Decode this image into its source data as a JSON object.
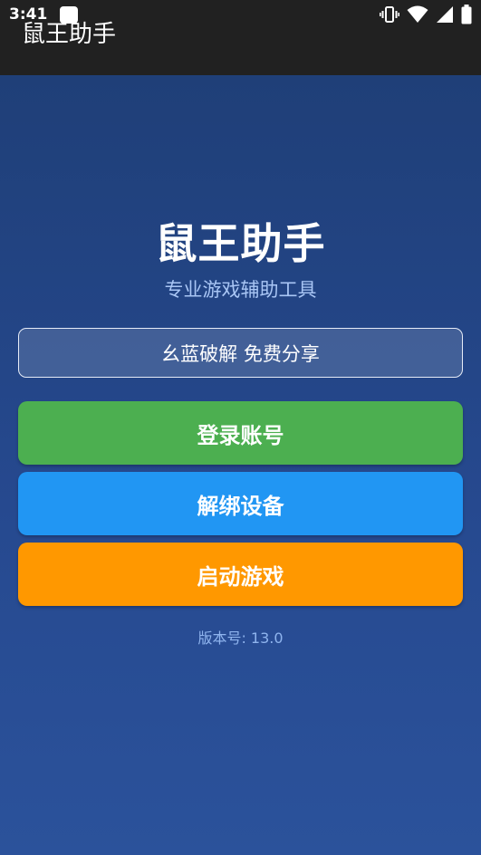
{
  "status_bar": {
    "time": "3:41",
    "icons": [
      "notification-icon",
      "vibrate-icon",
      "wifi-icon",
      "signal-icon",
      "battery-icon"
    ]
  },
  "app_bar": {
    "title": "鼠王助手"
  },
  "main": {
    "title": "鼠王助手",
    "subtitle": "专业游戏辅助工具",
    "notice": "幺蓝破解 免费分享",
    "buttons": {
      "login": "登录账号",
      "unbind": "解绑设备",
      "start": "启动游戏"
    },
    "version": "版本号: 13.0"
  },
  "colors": {
    "background_top": "#1f3f78",
    "background_bottom": "#2b529b",
    "login_button": "#4caf50",
    "unbind_button": "#2196f3",
    "start_button": "#ff9800",
    "subtitle": "#a9c6f5",
    "version": "#8fb4ee"
  }
}
